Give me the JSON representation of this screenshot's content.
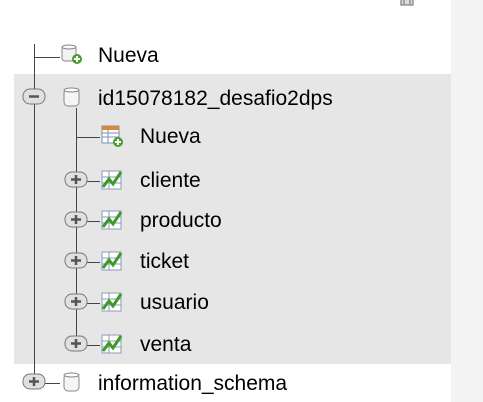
{
  "tree": {
    "new_server_item": {
      "label": "Nueva",
      "icon": "new-database-icon"
    },
    "databases": [
      {
        "name": "id15078182_desafio2dps",
        "expanded": true,
        "icon": "database-icon",
        "expander": "minus",
        "new_table_label": "Nueva",
        "tables": [
          {
            "name": "cliente",
            "icon": "table-icon",
            "expander": "plus"
          },
          {
            "name": "producto",
            "icon": "table-icon",
            "expander": "plus"
          },
          {
            "name": "ticket",
            "icon": "table-icon",
            "expander": "plus"
          },
          {
            "name": "usuario",
            "icon": "table-icon",
            "expander": "plus"
          },
          {
            "name": "venta",
            "icon": "table-icon",
            "expander": "plus"
          }
        ]
      },
      {
        "name": "information_schema",
        "expanded": false,
        "icon": "database-icon",
        "expander": "plus"
      }
    ]
  },
  "colors": {
    "selected_background": "#e6e6e6",
    "side_strip": "#f3f3f3",
    "tree_lines": "#444444",
    "table_icon_green": "#3d9a24",
    "add_badge_green": "#4a9e2f"
  }
}
